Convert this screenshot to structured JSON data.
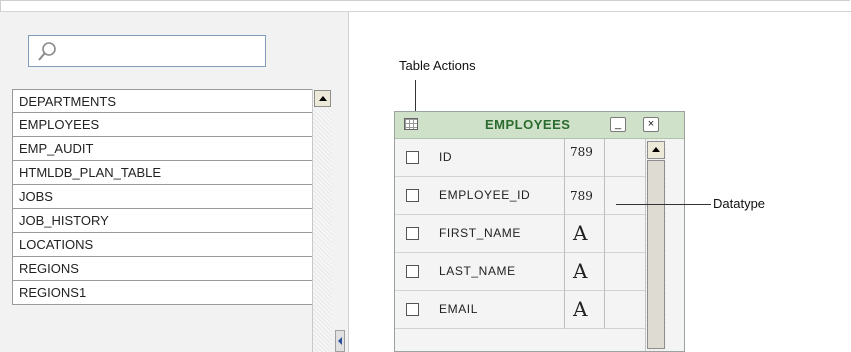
{
  "sidebar": {
    "search": {
      "placeholder": "",
      "value": ""
    },
    "tables": [
      "DEPARTMENTS",
      "EMPLOYEES",
      "EMP_AUDIT",
      "HTMLDB_PLAN_TABLE",
      "JOBS",
      "JOB_HISTORY",
      "LOCATIONS",
      "REGIONS",
      "REGIONS1"
    ]
  },
  "annotations": {
    "table_actions": "Table Actions",
    "datatype": "Datatype"
  },
  "table_card": {
    "title": "EMPLOYEES",
    "minimize_symbol": "_",
    "close_symbol": "×",
    "columns": [
      {
        "name": "ID",
        "type_symbol": "789",
        "type": "number"
      },
      {
        "name": "EMPLOYEE_ID",
        "type_symbol": "789",
        "type": "number"
      },
      {
        "name": "FIRST_NAME",
        "type_symbol": "A",
        "type": "text"
      },
      {
        "name": "LAST_NAME",
        "type_symbol": "A",
        "type": "text"
      },
      {
        "name": "EMAIL",
        "type_symbol": "A",
        "type": "text"
      }
    ]
  },
  "icons": {
    "search": "magnifier-icon",
    "table": "table-grid-icon",
    "minimize": "minimize-icon",
    "close": "close-icon"
  },
  "colors": {
    "header_bg": "#cfe1c9",
    "header_text": "#2c6b2f"
  }
}
